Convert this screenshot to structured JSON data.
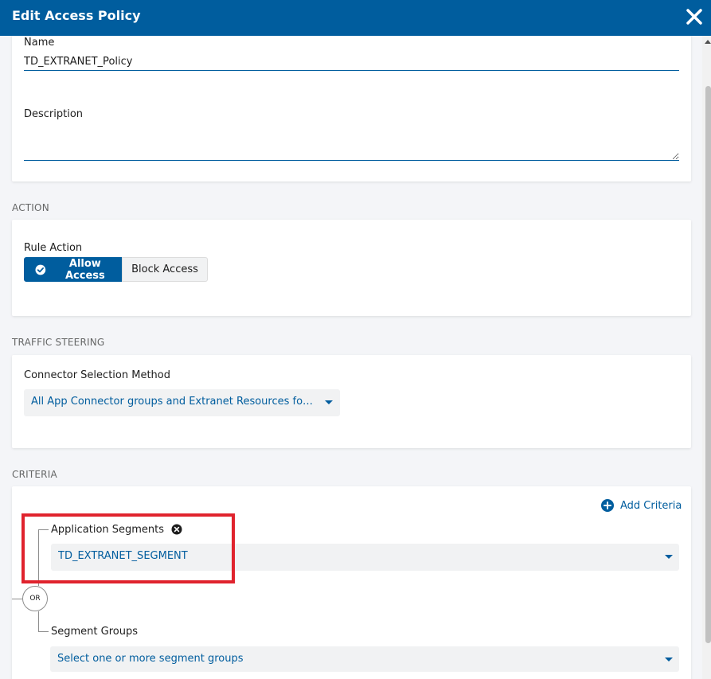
{
  "header": {
    "title": "Edit Access Policy"
  },
  "general": {
    "name_label": "Name",
    "name_value": "TD_EXTRANET_Policy",
    "description_label": "Description",
    "description_value": ""
  },
  "action": {
    "section_title": "ACTION",
    "rule_action_label": "Rule Action",
    "allow_label": "Allow Access",
    "block_label": "Block Access",
    "selected": "Allow Access"
  },
  "traffic": {
    "section_title": "TRAFFIC STEERING",
    "connector_label": "Connector Selection Method",
    "connector_value": "All App Connector groups and Extranet Resources for t..."
  },
  "criteria": {
    "section_title": "CRITERIA",
    "add_label": "Add Criteria",
    "or_label": "OR",
    "app_segments_label": "Application Segments",
    "app_segments_value": "TD_EXTRANET_SEGMENT",
    "segment_groups_label": "Segment Groups",
    "segment_groups_placeholder": "Select one or more segment groups"
  },
  "colors": {
    "header": "#005d9e",
    "accent": "#005d9e",
    "highlight": "#e0232d",
    "page_bg": "#f4f5f8"
  }
}
